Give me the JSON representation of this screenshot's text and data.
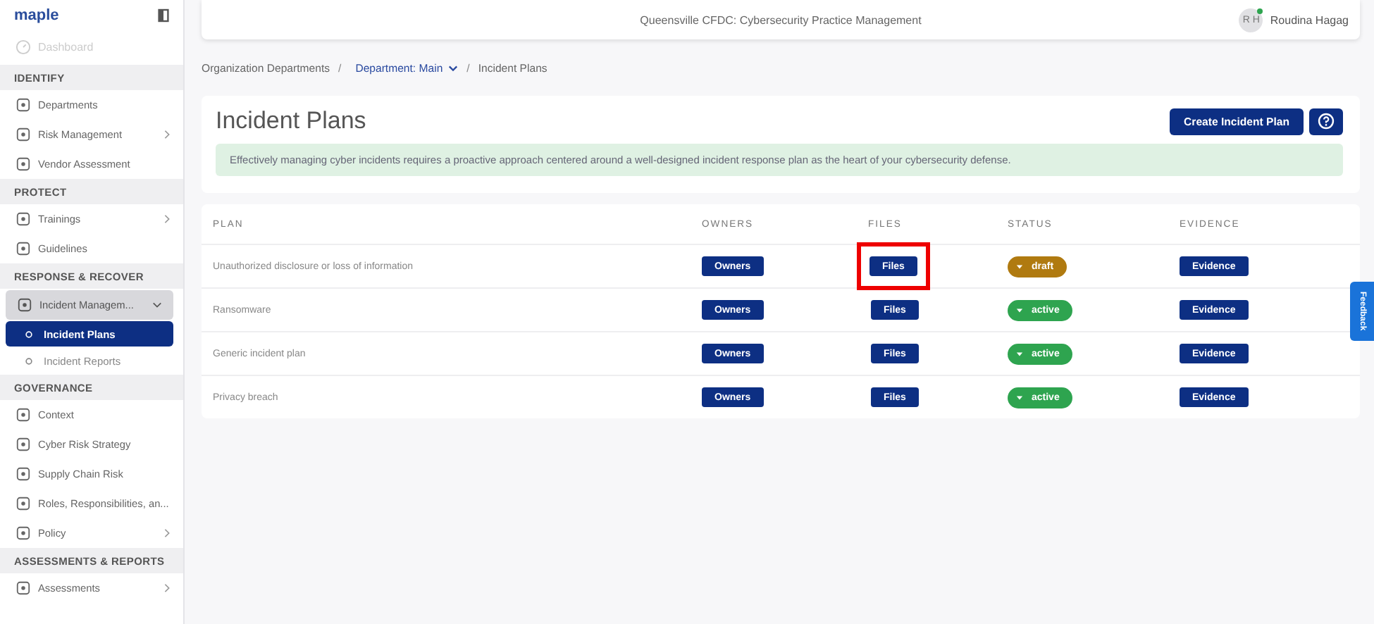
{
  "logo": {
    "text": "maple"
  },
  "sidebar": {
    "top_item": {
      "label": "Dashboard",
      "disabled": true
    },
    "sections": [
      {
        "title": "IDENTIFY",
        "items": [
          {
            "label": "Departments",
            "has_submenu": false,
            "expanded": false
          },
          {
            "label": "Risk Management",
            "has_submenu": true,
            "expanded": false
          },
          {
            "label": "Vendor Assessment",
            "has_submenu": false,
            "expanded": false
          }
        ]
      },
      {
        "title": "PROTECT",
        "items": [
          {
            "label": "Trainings",
            "has_submenu": true,
            "expanded": false
          },
          {
            "label": "Guidelines",
            "has_submenu": false,
            "expanded": false
          }
        ]
      },
      {
        "title": "RESPONSE & RECOVER",
        "items": [
          {
            "label": "Incident Managem...",
            "has_submenu": true,
            "expanded": true,
            "children": [
              {
                "label": "Incident Plans",
                "selected": true
              },
              {
                "label": "Incident Reports",
                "selected": false
              }
            ]
          }
        ]
      },
      {
        "title": "GOVERNANCE",
        "items": [
          {
            "label": "Context",
            "has_submenu": false,
            "expanded": false
          },
          {
            "label": "Cyber Risk Strategy",
            "has_submenu": false,
            "expanded": false
          },
          {
            "label": "Supply Chain Risk",
            "has_submenu": false,
            "expanded": false
          },
          {
            "label": "Roles, Responsibilities, an...",
            "has_submenu": false,
            "expanded": false
          },
          {
            "label": "Policy",
            "has_submenu": true,
            "expanded": false
          }
        ]
      },
      {
        "title": "ASSESSMENTS & REPORTS",
        "items": [
          {
            "label": "Assessments",
            "has_submenu": true,
            "expanded": false
          }
        ]
      }
    ]
  },
  "header": {
    "title": "Queensville CFDC: Cybersecurity Practice Management",
    "user": {
      "initials": "R H",
      "name": "Roudina Hagag",
      "online": true
    }
  },
  "breadcrumb": {
    "separator": "/",
    "items": [
      {
        "label": "Organization Departments",
        "kind": "link"
      },
      {
        "label": "Department: Main",
        "kind": "dropdown"
      },
      {
        "label": "Incident Plans",
        "kind": "current"
      }
    ]
  },
  "page": {
    "title": "Incident Plans",
    "create_button": "Create Incident Plan",
    "info": "Effectively managing cyber incidents requires a proactive approach centered around a well-designed incident response plan as the heart of your cybersecurity defense."
  },
  "table": {
    "columns": [
      "PLAN",
      "OWNERS",
      "FILES",
      "STATUS",
      "EVIDENCE"
    ],
    "rows": [
      {
        "plan": "Unauthorized disclosure or loss of information",
        "owners": "Owners",
        "files": "Files",
        "files_highlighted": true,
        "status": "draft",
        "color": "#b07a10",
        "evidence": "Evidence"
      },
      {
        "plan": "Ransomware",
        "owners": "Owners",
        "files": "Files",
        "files_highlighted": false,
        "status": "active",
        "color": "#2ea44f",
        "evidence": "Evidence"
      },
      {
        "plan": "Generic incident plan",
        "owners": "Owners",
        "files": "Files",
        "files_highlighted": false,
        "status": "active",
        "color": "#2ea44f",
        "evidence": "Evidence"
      },
      {
        "plan": "Privacy breach",
        "owners": "Owners",
        "files": "Files",
        "files_highlighted": false,
        "status": "active",
        "color": "#2ea44f",
        "evidence": "Evidence"
      }
    ]
  },
  "feedback_tab": "Feedback"
}
